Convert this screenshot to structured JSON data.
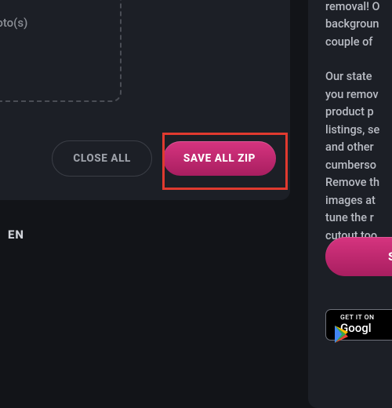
{
  "dropzone": {
    "label": "ct photo(s)"
  },
  "buttons": {
    "close_all": "CLOSE ALL",
    "save_all_zip": "SAVE ALL ZIP"
  },
  "language": "EN",
  "sidebar": {
    "p1": "removal! O\nbackgroun\ncouple of",
    "p2": "Our state\nyou remov\nproduct p\nlistings, se\nand other\ncumberso\nRemove th\nimages at\ntune the r\ncutout too",
    "cta": "S"
  },
  "store": {
    "small": "GET IT ON",
    "big": "Googl"
  }
}
